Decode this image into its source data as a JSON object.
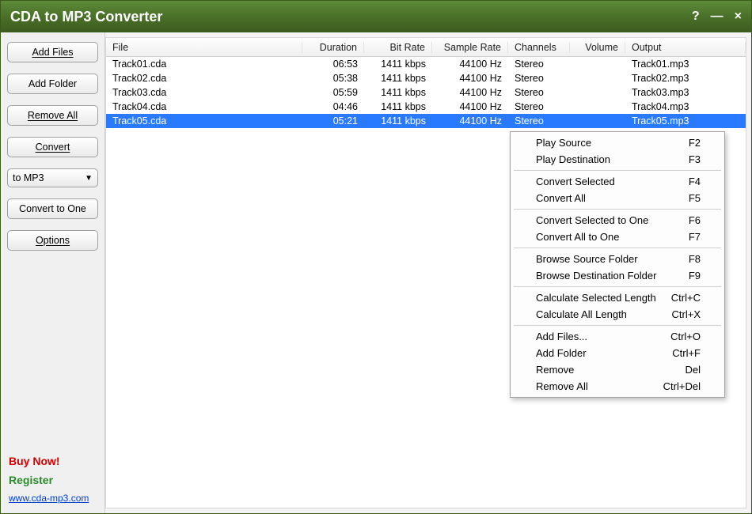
{
  "title": "CDA to MP3 Converter",
  "windowControls": {
    "help": "?",
    "min": "—",
    "close": "×"
  },
  "sidebar": {
    "addFiles": "Add Files",
    "addFolder": "Add Folder",
    "removeAll": "Remove All",
    "convert": "Convert",
    "formatSelect": "to MP3",
    "convertToOne": "Convert to One",
    "options": "Options",
    "buy": "Buy Now!",
    "register": "Register",
    "url": "www.cda-mp3.com"
  },
  "columns": {
    "file": "File",
    "duration": "Duration",
    "bitrate": "Bit Rate",
    "sample": "Sample Rate",
    "channels": "Channels",
    "volume": "Volume",
    "output": "Output"
  },
  "rows": [
    {
      "file": "Track01.cda",
      "dur": "06:53",
      "bit": "1411 kbps",
      "samp": "44100 Hz",
      "chan": "Stereo",
      "vol": "",
      "out": "Track01.mp3",
      "sel": false
    },
    {
      "file": "Track02.cda",
      "dur": "05:38",
      "bit": "1411 kbps",
      "samp": "44100 Hz",
      "chan": "Stereo",
      "vol": "",
      "out": "Track02.mp3",
      "sel": false
    },
    {
      "file": "Track03.cda",
      "dur": "05:59",
      "bit": "1411 kbps",
      "samp": "44100 Hz",
      "chan": "Stereo",
      "vol": "",
      "out": "Track03.mp3",
      "sel": false
    },
    {
      "file": "Track04.cda",
      "dur": "04:46",
      "bit": "1411 kbps",
      "samp": "44100 Hz",
      "chan": "Stereo",
      "vol": "",
      "out": "Track04.mp3",
      "sel": false
    },
    {
      "file": "Track05.cda",
      "dur": "05:21",
      "bit": "1411 kbps",
      "samp": "44100 Hz",
      "chan": "Stereo",
      "vol": "",
      "out": "Track05.mp3",
      "sel": true
    }
  ],
  "menu": [
    {
      "label": "Play Source",
      "shortcut": "F2"
    },
    {
      "label": "Play Destination",
      "shortcut": "F3"
    },
    {
      "sep": true
    },
    {
      "label": "Convert Selected",
      "shortcut": "F4"
    },
    {
      "label": "Convert All",
      "shortcut": "F5"
    },
    {
      "sep": true
    },
    {
      "label": "Convert Selected to One",
      "shortcut": "F6"
    },
    {
      "label": "Convert All to One",
      "shortcut": "F7"
    },
    {
      "sep": true
    },
    {
      "label": "Browse Source Folder",
      "shortcut": "F8"
    },
    {
      "label": "Browse Destination Folder",
      "shortcut": "F9"
    },
    {
      "sep": true
    },
    {
      "label": "Calculate Selected Length",
      "shortcut": "Ctrl+C"
    },
    {
      "label": "Calculate All Length",
      "shortcut": "Ctrl+X"
    },
    {
      "sep": true
    },
    {
      "label": "Add Files...",
      "shortcut": "Ctrl+O"
    },
    {
      "label": "Add Folder",
      "shortcut": "Ctrl+F"
    },
    {
      "label": "Remove",
      "shortcut": "Del"
    },
    {
      "label": "Remove All",
      "shortcut": "Ctrl+Del"
    }
  ]
}
